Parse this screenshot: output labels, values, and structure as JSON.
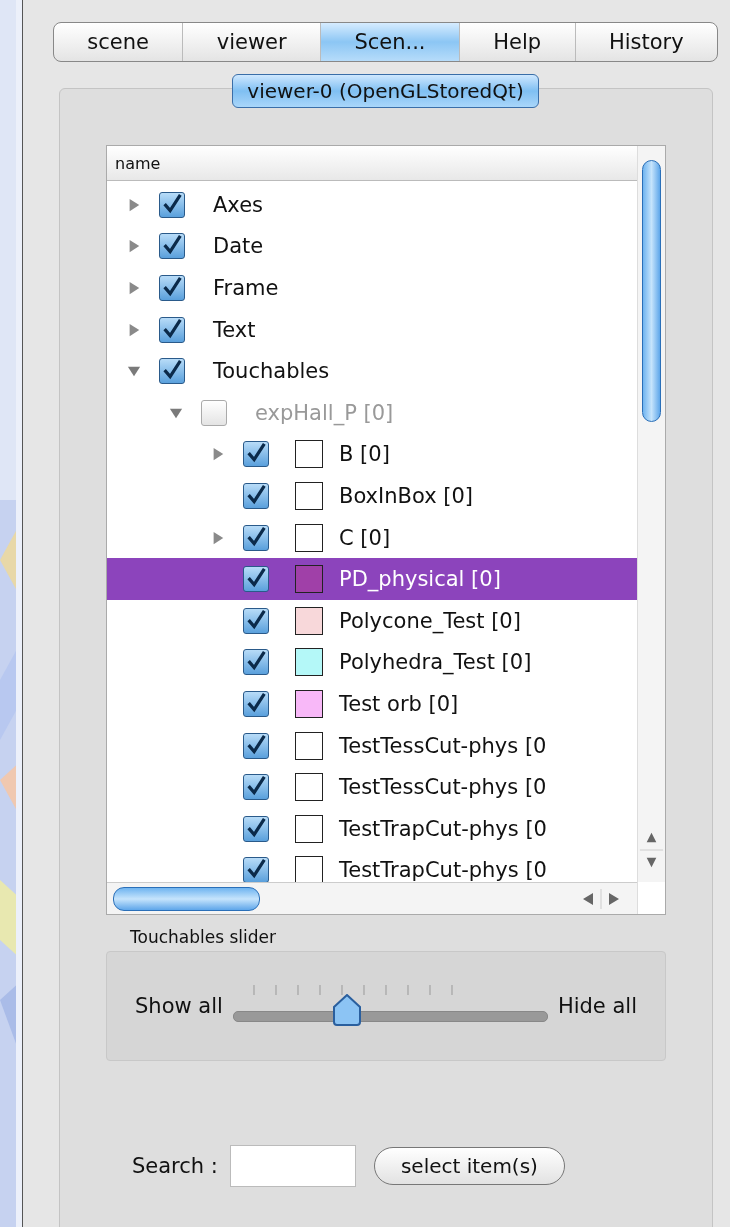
{
  "tabs": [
    {
      "label": "scene",
      "selected": false
    },
    {
      "label": "viewer",
      "selected": false
    },
    {
      "label": "Scen...",
      "selected": true
    },
    {
      "label": "Help",
      "selected": false
    },
    {
      "label": "History",
      "selected": false
    }
  ],
  "viewer_button": {
    "label": "viewer-0 (OpenGLStoredQt)"
  },
  "tree": {
    "column": "name",
    "items": [
      {
        "label": "Axes",
        "expandable": true,
        "expanded": false,
        "checked": true,
        "disabled": false,
        "selected": false
      },
      {
        "label": "Date",
        "expandable": true,
        "expanded": false,
        "checked": true,
        "disabled": false,
        "selected": false
      },
      {
        "label": "Frame",
        "expandable": true,
        "expanded": false,
        "checked": true,
        "disabled": false,
        "selected": false
      },
      {
        "label": "Text",
        "expandable": true,
        "expanded": false,
        "checked": true,
        "disabled": false,
        "selected": false
      },
      {
        "label": "Touchables",
        "expandable": true,
        "expanded": true,
        "checked": true,
        "disabled": false,
        "selected": false,
        "children": [
          {
            "label": "expHall_P [0]",
            "expandable": true,
            "expanded": true,
            "checked": false,
            "disabled": true,
            "selected": false,
            "children": [
              {
                "label": "B [0]",
                "expandable": true,
                "expanded": false,
                "checked": true,
                "disabled": false,
                "selected": false,
                "color": "#ffffff"
              },
              {
                "label": "BoxInBox [0]",
                "expandable": false,
                "checked": true,
                "disabled": false,
                "selected": false,
                "color": "#ffffff"
              },
              {
                "label": "C [0]",
                "expandable": true,
                "expanded": false,
                "checked": true,
                "disabled": false,
                "selected": false,
                "color": "#ffffff"
              },
              {
                "label": "PD_physical [0]",
                "expandable": false,
                "checked": true,
                "disabled": false,
                "selected": true,
                "color": "#a040a8"
              },
              {
                "label": "Polycone_Test [0]",
                "expandable": false,
                "checked": true,
                "disabled": false,
                "selected": false,
                "color": "#f8d8da"
              },
              {
                "label": "Polyhedra_Test [0]",
                "expandable": false,
                "checked": true,
                "disabled": false,
                "selected": false,
                "color": "#b4f8f8"
              },
              {
                "label": "Test orb [0]",
                "expandable": false,
                "checked": true,
                "disabled": false,
                "selected": false,
                "color": "#f8b8f8"
              },
              {
                "label": "TestTessCut-phys [0",
                "expandable": false,
                "checked": true,
                "disabled": false,
                "selected": false,
                "color": "#ffffff"
              },
              {
                "label": "TestTessCut-phys [0",
                "expandable": false,
                "checked": true,
                "disabled": false,
                "selected": false,
                "color": "#ffffff"
              },
              {
                "label": "TestTrapCut-phys [0",
                "expandable": false,
                "checked": true,
                "disabled": false,
                "selected": false,
                "color": "#ffffff"
              },
              {
                "label": "TestTrapCut-phys [0",
                "expandable": false,
                "checked": true,
                "disabled": false,
                "selected": false,
                "color": "#ffffff"
              }
            ]
          }
        ]
      }
    ]
  },
  "slider": {
    "title": "Touchables slider",
    "left_label": "Show all",
    "right_label": "Hide all",
    "level": 0.36
  },
  "search": {
    "label": "Search :",
    "button": "select item(s)"
  }
}
